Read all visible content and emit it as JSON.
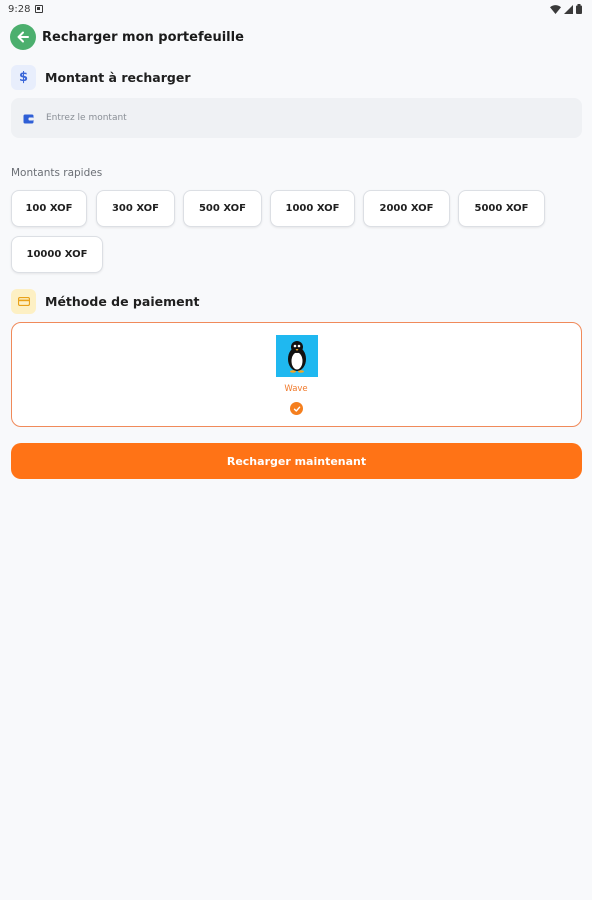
{
  "status_bar": {
    "time": "9:28"
  },
  "header": {
    "title": "Recharger mon portefeuille"
  },
  "amount_section": {
    "title": "Montant à recharger",
    "currency_symbol": "$",
    "input_placeholder": "Entrez le montant",
    "input_value": ""
  },
  "quick_amounts": {
    "label": "Montants rapides",
    "items": [
      "100 XOF",
      "300 XOF",
      "500 XOF",
      "1000 XOF",
      "2000 XOF",
      "5000 XOF",
      "10000 XOF"
    ]
  },
  "payment_section": {
    "title": "Méthode de paiement",
    "methods": [
      {
        "name": "Wave",
        "selected": true
      }
    ]
  },
  "cta": {
    "label": "Recharger maintenant"
  },
  "colors": {
    "accent": "#ff7316",
    "back_button": "#4caf6e",
    "wave_logo": "#1fb8f0",
    "selected_border": "#f08a5a"
  },
  "icons": {
    "back": "arrow-left-icon",
    "currency": "dollar-icon",
    "wallet": "wallet-icon",
    "card": "card-icon",
    "check": "check-circle-icon"
  }
}
